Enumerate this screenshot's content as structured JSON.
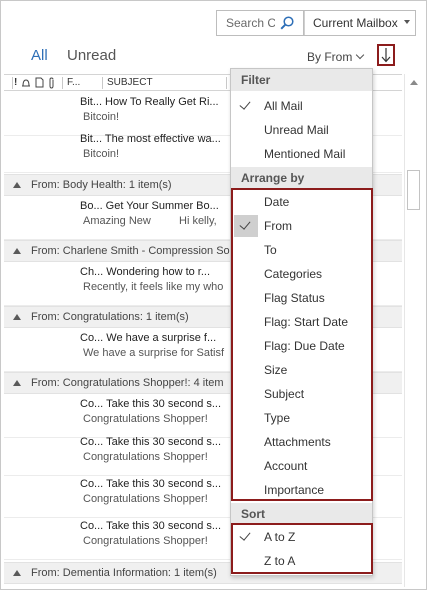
{
  "search": {
    "placeholder": "Search C",
    "scope": "Current Mailbox"
  },
  "tabs": {
    "all": "All",
    "unread": "Unread"
  },
  "sort_control": {
    "label": "By From"
  },
  "columns": {
    "from_abbr": "F...",
    "subject": "SUBJECT"
  },
  "messages": [
    {
      "subject": "Bit... How To Really Get Ri...",
      "preview": "Bitcoin!"
    },
    {
      "subject": "Bit... The most effective wa...",
      "preview": "Bitcoin!"
    },
    {
      "subject": "Bo... Get Your Summer Bo...",
      "preview": "Amazing New",
      "preview2": "Hi kelly,"
    },
    {
      "subject": "Ch... Wondering how to r...",
      "preview": "Recently, it feels like my who"
    },
    {
      "subject": "Co... We have a surprise f...",
      "preview": "We have a surprise for Satisf"
    },
    {
      "subject": "Co... Take this 30 second s...",
      "preview": "Congratulations Shopper!"
    },
    {
      "subject": "Co... Take this 30 second s...",
      "preview": "Congratulations Shopper!"
    },
    {
      "subject": "Co... Take this 30 second s...",
      "preview": "Congratulations Shopper!"
    },
    {
      "subject": "Co... Take this 30 second s...",
      "preview": "Congratulations Shopper!"
    }
  ],
  "groups": [
    {
      "label": "From: Body Health: 1 item(s)"
    },
    {
      "label": "From: Charlene Smith - Compression So"
    },
    {
      "label": "From: Congratulations: 1 item(s)"
    },
    {
      "label": "From: Congratulations Shopper!: 4 item"
    },
    {
      "label": "From: Dementia Information: 1 item(s)"
    }
  ],
  "menu": {
    "filter_header": "Filter",
    "filter_items": [
      {
        "label": "All Mail",
        "checked": true
      },
      {
        "label": "Unread Mail",
        "checked": false
      },
      {
        "label": "Mentioned Mail",
        "checked": false
      }
    ],
    "arrange_header": "Arrange by",
    "arrange_items": [
      {
        "label": "Date",
        "selected": false
      },
      {
        "label": "From",
        "selected": true
      },
      {
        "label": "To",
        "selected": false
      },
      {
        "label": "Categories",
        "selected": false
      },
      {
        "label": "Flag Status",
        "selected": false
      },
      {
        "label": "Flag: Start Date",
        "selected": false
      },
      {
        "label": "Flag: Due Date",
        "selected": false
      },
      {
        "label": "Size",
        "selected": false
      },
      {
        "label": "Subject",
        "selected": false
      },
      {
        "label": "Type",
        "selected": false
      },
      {
        "label": "Attachments",
        "selected": false
      },
      {
        "label": "Account",
        "selected": false
      },
      {
        "label": "Importance",
        "selected": false
      }
    ],
    "sort_header": "Sort",
    "sort_items": [
      {
        "label": "A to Z",
        "checked": true
      },
      {
        "label": "Z to A",
        "checked": false
      }
    ]
  },
  "colors": {
    "accent": "#2e6fb7",
    "highlight_border": "#8c1c1c",
    "menu_header_bg": "#e9e9e9",
    "group_bg": "#f0f0f0"
  }
}
